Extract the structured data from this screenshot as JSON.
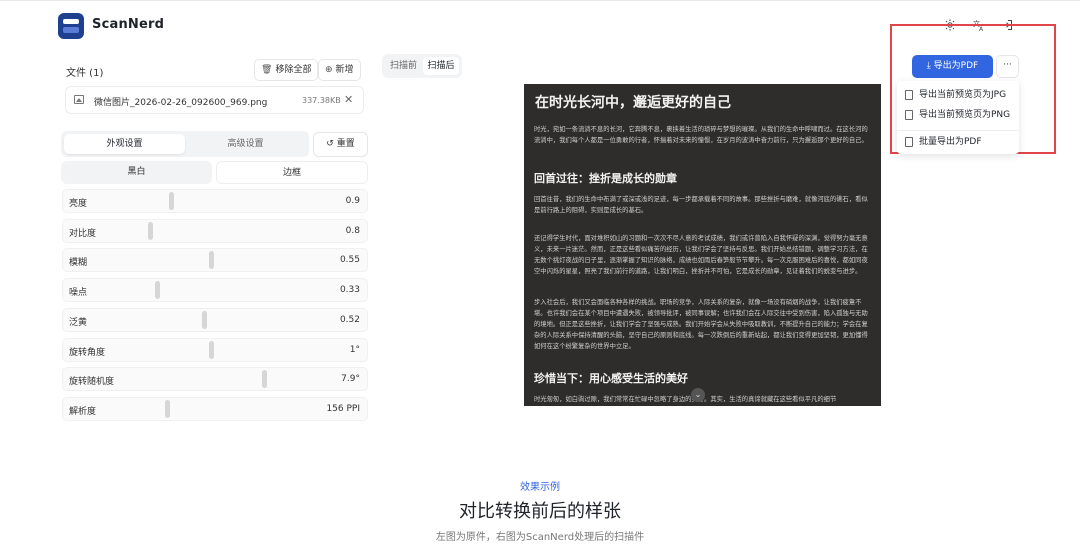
{
  "app": {
    "name": "ScanNerd"
  },
  "top_icons": [
    "sun-icon",
    "translate-icon",
    "logout-icon"
  ],
  "files": {
    "title": "文件 (1)",
    "remove_all": "移除全部",
    "add_new": "新增",
    "items": [
      {
        "name": "微信图片_2026-02-26_092600_969.png",
        "size": "337.38KB"
      }
    ]
  },
  "settings": {
    "tabs": [
      "外观设置",
      "高级设置"
    ],
    "active_tab": "外观设置",
    "reset": "重置",
    "modes": [
      "黑白",
      "边框"
    ],
    "active_mode": "黑白",
    "sliders": [
      {
        "label": "亮度",
        "value": "0.9",
        "fraction": 0.38
      },
      {
        "label": "对比度",
        "value": "0.8",
        "fraction": 0.29
      },
      {
        "label": "模糊",
        "value": "0.55",
        "fraction": 0.55
      },
      {
        "label": "噪点",
        "value": "0.33",
        "fraction": 0.32
      },
      {
        "label": "泛黄",
        "value": "0.52",
        "fraction": 0.52
      },
      {
        "label": "旋转角度",
        "value": "1°",
        "fraction": 0.55
      },
      {
        "label": "旋转随机度",
        "value": "7.9°",
        "fraction": 0.78
      },
      {
        "label": "解析度",
        "value": "156 PPI",
        "fraction": 0.36
      }
    ]
  },
  "preview": {
    "toggle": [
      "扫描前",
      "扫描后"
    ],
    "active": "扫描后",
    "doc": {
      "title": "在时光长河中，邂逅更好的自己",
      "p1": "时光，宛如一条流淌不息的长河，它奔腾不息，裹挟着生活的琐碎与梦想的璀璨。从我们的生命中呼啸而过。在这长河的流淌中，我们每个人都是一位勇敢的行者，怀揣着对未来的憧憬，在岁月的波涛中奋力前行，只为邂逅那个更好的自己。",
      "h2": "回首过往：挫折是成长的勋章",
      "p2": "回首往昔，我们的生命中布满了或深或浅的足迹，每一步都承载着不同的故事。那些挫折与磨难，就像河底的礁石，看似是前行路上的阻碍，实则是成长的基石。",
      "p3": "还记得学生时代，面对堆积如山的习题和一次次不尽人意的考试成绩，我们或许曾陷入自我怀疑的深渊，觉得努力毫无意义，未来一片迷茫。然而，正是这些看似痛苦的经历，让我们学会了坚持与反思。我们开始总结错题，调整学习方法，在无数个挑灯夜战的日子里，逐渐掌握了知识的脉络，成绩也如雨后春笋般节节攀升。每一次克服困难后的喜悦，都如同夜空中闪烁的星星，照亮了我们前行的道路，让我们明白，挫折并不可怕，它是成长的勋章，见证着我们的蜕变与进步。",
      "p4": "步入社会后，我们又会面临各种各样的挑战。职场的竞争，人际关系的复杂，就像一场没有硝烟的战争，让我们疲惫不堪。也许我们会在某个项目中遭遇失败，被领导批评，被同事误解；也许我们会在人际交往中受到伤害，陷入孤独与无助的境地。但正是这些挫折，让我们学会了坚强与成熟。我们开始学会从失败中吸取教训，不断提升自己的能力；学会在复杂的人际关系中保持清醒的头脑，坚守自己的原则和底线。每一次跌倒后的重新站起，都让我们变得更加坚韧，更加懂得如何在这个纷繁复杂的世界中立足。",
      "h3": "珍惜当下：用心感受生活的美好",
      "p5": "时光匆匆，如白驹过隙，我们常常在忙碌中忽略了身边的美好。其实，生活的真谛就藏在这些看似平凡的细节"
    }
  },
  "export": {
    "button": "导出为PDF",
    "more": "···",
    "menu": [
      "导出当前预览页为JPG",
      "导出当前预览页为PNG",
      "批量导出为PDF"
    ]
  },
  "example": {
    "tag": "效果示例",
    "title": "对比转换前后的样张",
    "subtitle": "左图为原件，右图为ScanNerd处理后的扫描件"
  }
}
